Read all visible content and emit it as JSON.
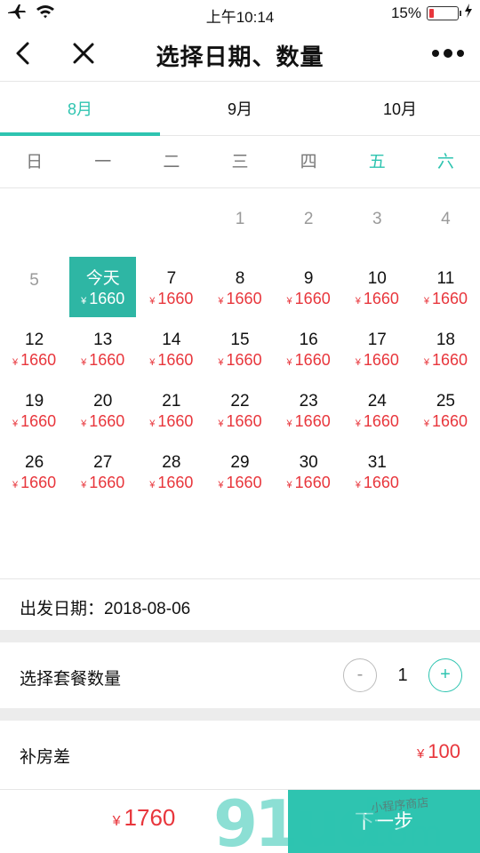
{
  "status_bar": {
    "time": "上午10:14",
    "battery_percent": "15%",
    "battery_level": 0.15
  },
  "navbar": {
    "title": "选择日期、数量"
  },
  "month_tabs": [
    {
      "label": "8月",
      "active": true
    },
    {
      "label": "9月",
      "active": false
    },
    {
      "label": "10月",
      "active": false
    }
  ],
  "weekdays": [
    "日",
    "一",
    "二",
    "三",
    "四",
    "五",
    "六"
  ],
  "calendar": {
    "currency": "¥",
    "today_label": "今天",
    "weeks": [
      [
        null,
        null,
        null,
        {
          "day": "1",
          "price": null
        },
        {
          "day": "2",
          "price": null
        },
        {
          "day": "3",
          "price": null
        },
        {
          "day": "4",
          "price": null
        }
      ],
      [
        {
          "day": "5",
          "price": null
        },
        {
          "day": "今天",
          "price": "1660",
          "today": true
        },
        {
          "day": "7",
          "price": "1660"
        },
        {
          "day": "8",
          "price": "1660"
        },
        {
          "day": "9",
          "price": "1660"
        },
        {
          "day": "10",
          "price": "1660"
        },
        {
          "day": "11",
          "price": "1660"
        }
      ],
      [
        {
          "day": "12",
          "price": "1660"
        },
        {
          "day": "13",
          "price": "1660"
        },
        {
          "day": "14",
          "price": "1660"
        },
        {
          "day": "15",
          "price": "1660"
        },
        {
          "day": "16",
          "price": "1660"
        },
        {
          "day": "17",
          "price": "1660"
        },
        {
          "day": "18",
          "price": "1660"
        }
      ],
      [
        {
          "day": "19",
          "price": "1660"
        },
        {
          "day": "20",
          "price": "1660"
        },
        {
          "day": "21",
          "price": "1660"
        },
        {
          "day": "22",
          "price": "1660"
        },
        {
          "day": "23",
          "price": "1660"
        },
        {
          "day": "24",
          "price": "1660"
        },
        {
          "day": "25",
          "price": "1660"
        }
      ],
      [
        {
          "day": "26",
          "price": "1660"
        },
        {
          "day": "27",
          "price": "1660"
        },
        {
          "day": "28",
          "price": "1660"
        },
        {
          "day": "29",
          "price": "1660"
        },
        {
          "day": "30",
          "price": "1660"
        },
        {
          "day": "31",
          "price": "1660"
        },
        null
      ]
    ]
  },
  "departure": {
    "label": "出发日期：",
    "value": "2018-08-06"
  },
  "package": {
    "label": "选择套餐数量",
    "minus": "-",
    "quantity": "1",
    "plus": "+"
  },
  "room_surcharge": {
    "label": "补房差",
    "currency": "¥",
    "amount": "100"
  },
  "footer": {
    "currency": "¥",
    "total": "1760",
    "next_label": "下一步"
  },
  "watermark": {
    "brand": "91ud.com",
    "tagline": "小程序商店"
  },
  "colors": {
    "accent": "#2ec4b0",
    "price": "#e8363c",
    "separator": "#ececec"
  }
}
